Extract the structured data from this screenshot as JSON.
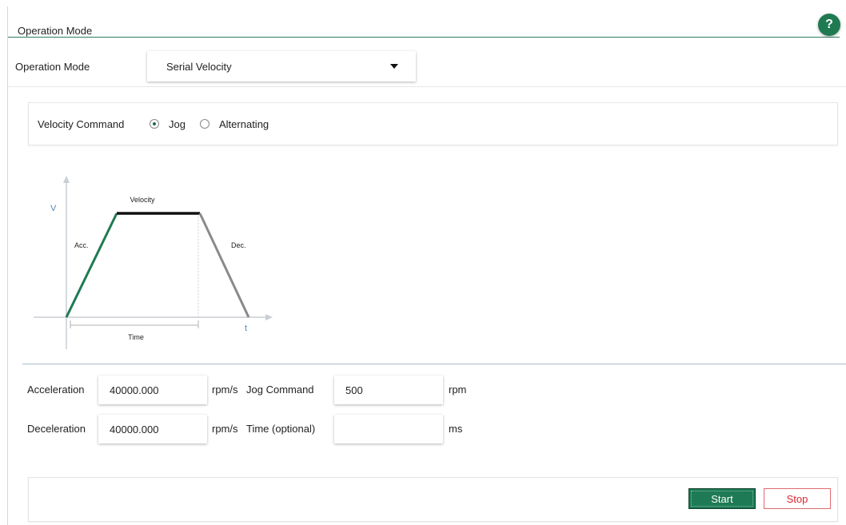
{
  "section": {
    "title": "Operation Mode",
    "help_label": "?"
  },
  "operation_mode": {
    "label": "Operation Mode",
    "selected": "Serial Velocity"
  },
  "velocity_command": {
    "label": "Velocity Command",
    "options": [
      {
        "label": "Jog",
        "checked": true
      },
      {
        "label": "Alternating",
        "checked": false
      }
    ]
  },
  "diagram": {
    "v_label": "V",
    "t_label": "t",
    "velocity_label": "Velocity",
    "acc_label": "Acc.",
    "dec_label": "Dec.",
    "time_label": "Time",
    "colors": {
      "acc": "#1f7a52",
      "flat": "#111111",
      "dec": "#8a8a8a",
      "axis": "#c9ced3"
    }
  },
  "fields": {
    "acceleration": {
      "label": "Acceleration",
      "value": "40000.000",
      "unit": "rpm/s"
    },
    "deceleration": {
      "label": "Deceleration",
      "value": "40000.000",
      "unit": "rpm/s"
    },
    "jog_command": {
      "label": "Jog Command",
      "value": "500",
      "unit": "rpm"
    },
    "time_optional": {
      "label": "Time (optional)",
      "value": "",
      "unit": "ms"
    }
  },
  "actions": {
    "start_label": "Start",
    "stop_label": "Stop"
  },
  "colors": {
    "accent": "#1e7a55",
    "stop": "#d9262f"
  }
}
